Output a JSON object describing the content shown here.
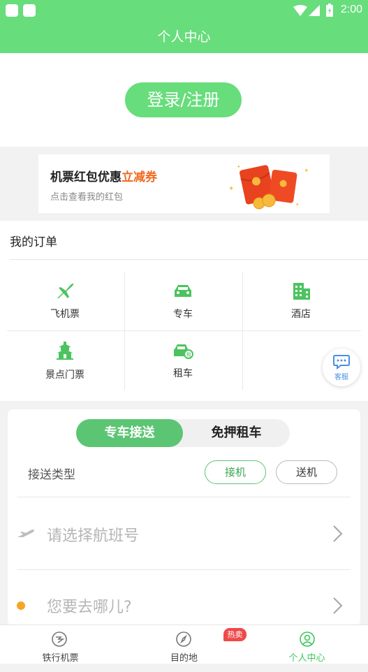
{
  "status_bar": {
    "time": "2:00"
  },
  "header": {
    "title": "个人中心"
  },
  "login": {
    "label": "登录/注册"
  },
  "promo": {
    "title_prefix": "机票红包优惠",
    "title_highlight": "立减券",
    "subtitle": "点击查看我的红包"
  },
  "orders": {
    "title": "我的订单",
    "items": [
      {
        "label": "飞机票",
        "icon": "plane-icon"
      },
      {
        "label": "专车",
        "icon": "car-icon"
      },
      {
        "label": "酒店",
        "icon": "hotel-icon"
      },
      {
        "label": "景点门票",
        "icon": "temple-icon"
      },
      {
        "label": "租车",
        "icon": "rental-car-icon"
      }
    ]
  },
  "customer_service": {
    "label": "客服",
    "icon": "chat-icon"
  },
  "transfer": {
    "tabs": [
      "专车接送",
      "免押租车"
    ],
    "active_tab": "专车接送",
    "type_label": "接送类型",
    "options": [
      "接机",
      "送机"
    ],
    "selected_option": "接机",
    "flight_placeholder": "请选择航班号",
    "destination_placeholder": "您要去哪儿?"
  },
  "tabbar": {
    "items": [
      {
        "label": "铁行机票",
        "icon": "ticket-icon"
      },
      {
        "label": "目的地",
        "icon": "compass-icon"
      },
      {
        "label": "个人中心",
        "icon": "user-icon"
      }
    ],
    "active": "个人中心",
    "badge": "热卖"
  },
  "colors": {
    "primary": "#67dd7c",
    "accent": "#5cc573",
    "highlight": "#f06a1f",
    "badge": "#ee4a4a",
    "dot": "#f5a623"
  }
}
